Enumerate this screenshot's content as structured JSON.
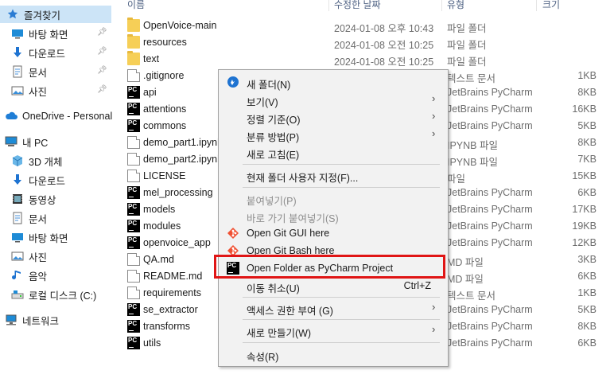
{
  "sidebar": {
    "items": [
      {
        "label": "즐겨찾기",
        "icon": "star-icon"
      },
      {
        "label": "바탕 화면",
        "icon": "desktop-icon",
        "pinned": true
      },
      {
        "label": "다운로드",
        "icon": "download-arrow-icon",
        "pinned": true
      },
      {
        "label": "문서",
        "icon": "document-icon",
        "pinned": true
      },
      {
        "label": "사진",
        "icon": "picture-icon",
        "pinned": true
      },
      {
        "label": "OneDrive - Personal",
        "icon": "cloud-icon"
      },
      {
        "label": "내 PC",
        "icon": "computer-icon"
      },
      {
        "label": "3D 개체",
        "icon": "cube-icon"
      },
      {
        "label": "다운로드",
        "icon": "download-arrow-icon"
      },
      {
        "label": "동영상",
        "icon": "video-icon"
      },
      {
        "label": "문서",
        "icon": "document-icon"
      },
      {
        "label": "바탕 화면",
        "icon": "desktop-icon"
      },
      {
        "label": "사진",
        "icon": "picture-icon"
      },
      {
        "label": "음악",
        "icon": "music-note-icon"
      },
      {
        "label": "로컬 디스크 (C:)",
        "icon": "drive-icon"
      },
      {
        "label": "네트워크",
        "icon": "network-icon"
      }
    ]
  },
  "columns": {
    "name": "이름",
    "date": "수정한 날짜",
    "type": "유형",
    "size": "크기"
  },
  "files": [
    {
      "name": "OpenVoice-main",
      "date": "2024-01-08 오후 10:43",
      "type": "파일 폴더",
      "size": "",
      "icon": "folder"
    },
    {
      "name": "resources",
      "date": "2024-01-08 오전 10:25",
      "type": "파일 폴더",
      "size": "",
      "icon": "folder"
    },
    {
      "name": "text",
      "date": "2024-01-08 오전 10:25",
      "type": "파일 폴더",
      "size": "",
      "icon": "folder"
    },
    {
      "name": ".gitignore",
      "date": "",
      "type": "텍스트 문서",
      "size": "1KB",
      "icon": "doc"
    },
    {
      "name": "api",
      "date": "",
      "type": "JetBrains PyCharm",
      "size": "8KB",
      "icon": "pycharm"
    },
    {
      "name": "attentions",
      "date": "",
      "type": "JetBrains PyCharm",
      "size": "16KB",
      "icon": "pycharm"
    },
    {
      "name": "commons",
      "date": "",
      "type": "JetBrains PyCharm",
      "size": "5KB",
      "icon": "pycharm"
    },
    {
      "name": "demo_part1.ipynb",
      "date": "",
      "type": "IPYNB 파일",
      "size": "8KB",
      "icon": "doc"
    },
    {
      "name": "demo_part2.ipynb",
      "date": "",
      "type": "IPYNB 파일",
      "size": "7KB",
      "icon": "doc"
    },
    {
      "name": "LICENSE",
      "date": "",
      "type": "파일",
      "size": "15KB",
      "icon": "doc"
    },
    {
      "name": "mel_processing",
      "date": "",
      "type": "JetBrains PyCharm",
      "size": "6KB",
      "icon": "pycharm"
    },
    {
      "name": "models",
      "date": "",
      "type": "JetBrains PyCharm",
      "size": "17KB",
      "icon": "pycharm"
    },
    {
      "name": "modules",
      "date": "",
      "type": "JetBrains PyCharm",
      "size": "19KB",
      "icon": "pycharm"
    },
    {
      "name": "openvoice_app",
      "date": "",
      "type": "JetBrains PyCharm",
      "size": "12KB",
      "icon": "pycharm"
    },
    {
      "name": "QA.md",
      "date": "",
      "type": "MD 파일",
      "size": "3KB",
      "icon": "doc"
    },
    {
      "name": "README.md",
      "date": "",
      "type": "MD 파일",
      "size": "6KB",
      "icon": "doc"
    },
    {
      "name": "requirements",
      "date": "",
      "type": "텍스트 문서",
      "size": "1KB",
      "icon": "doc"
    },
    {
      "name": "se_extractor",
      "date": "",
      "type": "JetBrains PyCharm",
      "size": "5KB",
      "icon": "pycharm"
    },
    {
      "name": "transforms",
      "date": "",
      "type": "JetBrains PyCharm",
      "size": "8KB",
      "icon": "pycharm"
    },
    {
      "name": "utils",
      "date": "",
      "type": "JetBrains PyCharm",
      "size": "6KB",
      "icon": "pycharm"
    }
  ],
  "context_menu": {
    "items": [
      {
        "label": "새 폴더(N)",
        "icon": "new-folder-icon",
        "submenu": false,
        "disabled": false
      },
      {
        "label": "보기(V)",
        "submenu": true,
        "disabled": false
      },
      {
        "label": "정렬 기준(O)",
        "submenu": true,
        "disabled": false
      },
      {
        "label": "분류 방법(P)",
        "submenu": true,
        "disabled": false
      },
      {
        "label": "새로 고침(E)",
        "submenu": false,
        "disabled": false
      },
      {
        "label": "현재 폴더 사용자 지정(F)...",
        "submenu": false,
        "disabled": false
      },
      {
        "label": "붙여넣기(P)",
        "submenu": false,
        "disabled": true
      },
      {
        "label": "바로 가기 붙여넣기(S)",
        "submenu": false,
        "disabled": true
      },
      {
        "label": "Open Git GUI here",
        "icon": "git-icon",
        "submenu": false,
        "disabled": false
      },
      {
        "label": "Open Git Bash here",
        "icon": "git-icon",
        "submenu": false,
        "disabled": false
      },
      {
        "label": "Open Folder as PyCharm Project",
        "icon": "pycharm-icon",
        "submenu": false,
        "disabled": false,
        "highlighted": true
      },
      {
        "label": "이동 취소(U)",
        "shortcut": "Ctrl+Z",
        "submenu": false,
        "disabled": false
      },
      {
        "label": "액세스 권한 부여 (G)",
        "submenu": true,
        "disabled": false
      },
      {
        "label": "새로 만들기(W)",
        "submenu": true,
        "disabled": false
      },
      {
        "label": "속성(R)",
        "submenu": false,
        "disabled": false
      }
    ]
  },
  "colors": {
    "selection": "#cce4f7",
    "highlight_border": "#e01515",
    "folder": "#f6cf57"
  }
}
